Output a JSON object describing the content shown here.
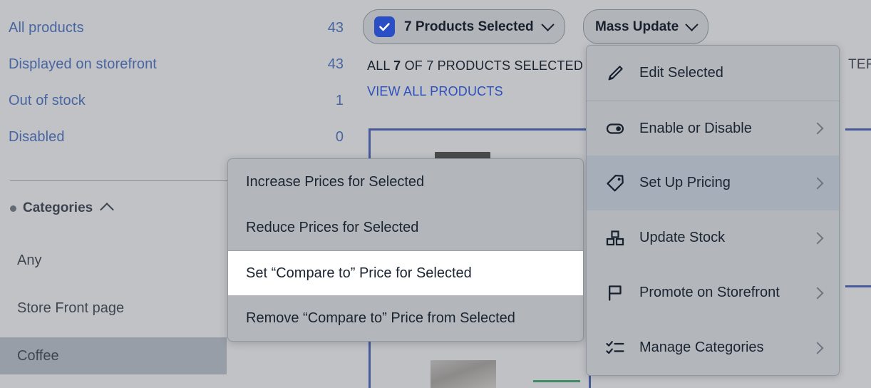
{
  "colors": {
    "link_blue": "#2c5cbf",
    "accent_blue": "#2a4fc4",
    "card_border": "#2c49b5",
    "text_dark": "#1b2431",
    "menu_bg": "#b3b7bb",
    "menu_active": "#a6aeb9",
    "highlight_bg": "#ffffff",
    "selected_row": "#b9c0c9"
  },
  "sidebar": {
    "links": [
      {
        "label": "All products",
        "count": "43"
      },
      {
        "label": "Displayed on storefront",
        "count": "43"
      },
      {
        "label": "Out of stock",
        "count": "1"
      },
      {
        "label": "Disabled",
        "count": "0"
      }
    ],
    "categories": {
      "heading": "Categories",
      "collapse_icon": "chevron-up-icon",
      "items": [
        {
          "label": "Any",
          "selected": false
        },
        {
          "label": "Store Front page",
          "selected": false
        },
        {
          "label": "Coffee",
          "selected": true
        }
      ]
    }
  },
  "toolbar": {
    "selection_button": {
      "label": "7 Products Selected",
      "checkbox_icon": "checkbox-checked-icon",
      "caret_icon": "chevron-down-icon"
    },
    "mass_update_button": {
      "label": "Mass Update",
      "caret_icon": "chevron-down-icon"
    },
    "status_prefix": "ALL ",
    "status_count": "7",
    "status_suffix": " OF 7 PRODUCTS SELECTED",
    "view_all_link": "VIEW ALL PRODUCTS"
  },
  "filters_label": "TERS:",
  "mass_update_menu": {
    "items": [
      {
        "label": "Edit Selected",
        "icon": "pencil-icon",
        "has_submenu": false,
        "divided": false,
        "active": false
      },
      {
        "label": "Enable or Disable",
        "icon": "toggle-icon",
        "has_submenu": true,
        "divided": true,
        "active": false
      },
      {
        "label": "Set Up Pricing",
        "icon": "price-tag-icon",
        "has_submenu": true,
        "divided": false,
        "active": true
      },
      {
        "label": "Update Stock",
        "icon": "boxes-icon",
        "has_submenu": true,
        "divided": false,
        "active": false
      },
      {
        "label": "Promote on Storefront",
        "icon": "flag-icon",
        "has_submenu": true,
        "divided": false,
        "active": false
      },
      {
        "label": "Manage Categories",
        "icon": "checklist-icon",
        "has_submenu": true,
        "divided": false,
        "active": false
      }
    ]
  },
  "pricing_submenu": {
    "items": [
      {
        "label": "Increase Prices for Selected",
        "divided": false,
        "highlighted": false
      },
      {
        "label": "Reduce Prices for Selected",
        "divided": false,
        "highlighted": false
      },
      {
        "label": "Set “Compare to” Price for Selected",
        "divided": true,
        "highlighted": true
      },
      {
        "label": "Remove “Compare to” Price from Selected",
        "divided": false,
        "highlighted": false
      }
    ]
  }
}
